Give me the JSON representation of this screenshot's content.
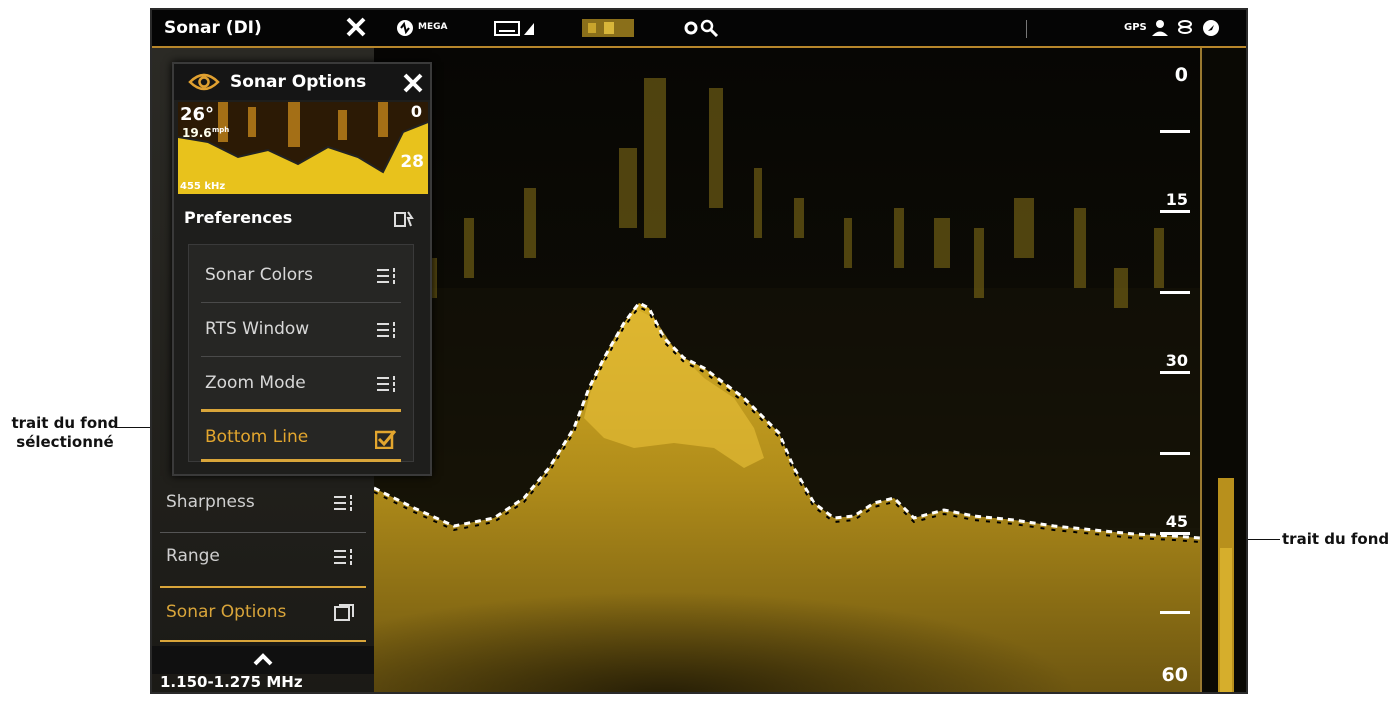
{
  "annotations": {
    "left_line1": "trait du fond",
    "left_line2": "sélectionné",
    "right": "trait du fond"
  },
  "topbar": {
    "title": "Sonar (DI)",
    "mega_label": "MEGA",
    "gps_label": "GPS"
  },
  "depth_scale": {
    "labels": [
      "0",
      "15",
      "30",
      "45",
      "60"
    ]
  },
  "left_menu": {
    "items": [
      {
        "label": "Sharpness"
      },
      {
        "label": "Range"
      },
      {
        "label": "Sonar Options"
      }
    ],
    "frequency": "1.150-1.275 MHz"
  },
  "popup": {
    "title": "Sonar Options",
    "preview": {
      "temp": "26°",
      "speed": "19.6",
      "speed_unit": "mph",
      "depth": "28",
      "top_depth": "0",
      "freq": "455 kHz"
    },
    "preferences_label": "Preferences",
    "items": [
      {
        "label": "Sonar Colors"
      },
      {
        "label": "RTS Window"
      },
      {
        "label": "Zoom Mode"
      },
      {
        "label": "Bottom Line",
        "checked": true
      }
    ]
  },
  "colors": {
    "accent": "#d9a53a",
    "sonar_yellow": "#c9a41c",
    "background": "#0c0a05"
  }
}
